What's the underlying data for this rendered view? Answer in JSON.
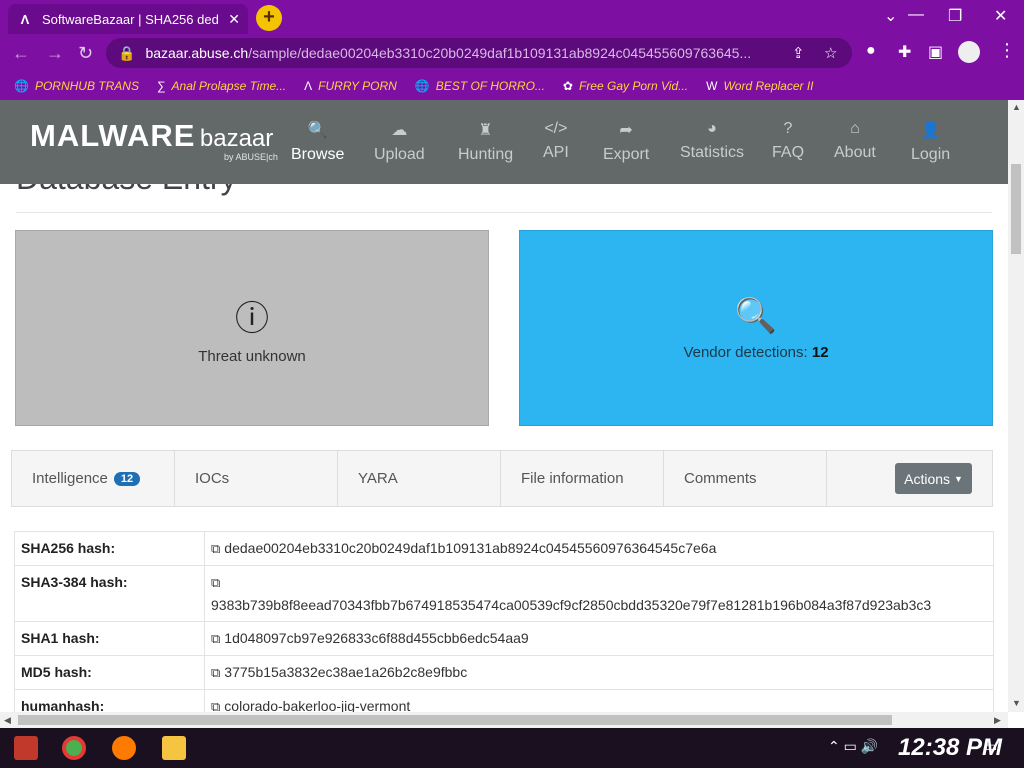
{
  "browser": {
    "tab_title": "SoftwareBazaar | SHA256 ded",
    "tab_icon": "Λ",
    "url_host": "bazaar.abuse.ch",
    "url_path": "/sample/dedae00204eb3310c20b0249daf1b109131ab8924c045455609763645..."
  },
  "bookmarks": [
    {
      "label": "PORNHUB TRANS",
      "icon": "🌐"
    },
    {
      "label": "Anal Prolapse Time...",
      "icon": "∑"
    },
    {
      "label": "FURRY PORN",
      "icon": "Λ"
    },
    {
      "label": "BEST OF HORRO...",
      "icon": "🌐"
    },
    {
      "label": "Free Gay Porn Vid...",
      "icon": "✿"
    },
    {
      "label": "Word Replacer II",
      "icon": "W"
    }
  ],
  "site": {
    "logo_main": "MALWARE",
    "logo_sub": "bazaar",
    "logo_by": "by ABUSE|ch",
    "nav": [
      {
        "label": "Browse",
        "icon": "🔍"
      },
      {
        "label": "Upload",
        "icon": "☁"
      },
      {
        "label": "Hunting",
        "icon": "♜"
      },
      {
        "label": "API",
        "icon": "</>"
      },
      {
        "label": "Export",
        "icon": "➦"
      },
      {
        "label": "Statistics",
        "icon": "◕"
      },
      {
        "label": "FAQ",
        "icon": "?"
      },
      {
        "label": "About",
        "icon": "⌂"
      },
      {
        "label": "Login",
        "icon": "👤"
      }
    ]
  },
  "page": {
    "section_title": "Database Entry",
    "threat_label": "Threat unknown",
    "vendor_label": "Vendor detections:",
    "vendor_count": "12"
  },
  "tabs": [
    {
      "label": "Intelligence",
      "badge": "12"
    },
    {
      "label": "IOCs"
    },
    {
      "label": "YARA"
    },
    {
      "label": "File information"
    },
    {
      "label": "Comments"
    }
  ],
  "actions_label": "Actions",
  "hashes": [
    {
      "key": "SHA256 hash:",
      "value": "dedae00204eb3310c20b0249daf1b109131ab8924c04545560976364545c7e6a"
    },
    {
      "key": "SHA3-384 hash:",
      "value": "9383b739b8f8eead70343fbb7b674918535474ca00539cf9cf2850cbdd35320e79f7e81281b196b084a3f87d923ab3c3"
    },
    {
      "key": "SHA1 hash:",
      "value": "1d048097cb97e926833c6f88d455cbb6edc54aa9"
    },
    {
      "key": "MD5 hash:",
      "value": "3775b15a3832ec38ae1a26b2c8e9fbbc"
    },
    {
      "key": "humanhash:",
      "value": "colorado-bakerloo-jig-vermont"
    }
  ],
  "taskbar": {
    "clock": "12:38 PM"
  }
}
